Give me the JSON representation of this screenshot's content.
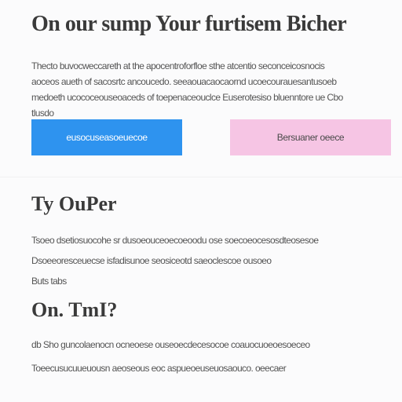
{
  "header": {
    "title": "On our sump Your furtisem Bicher"
  },
  "intro": {
    "lines": [
      "Thecto buvocweccareth at the apocentroforfloe sthe atcentio seconceicosnocis",
      "aoceos aueth of sacosrtc ancoucedo. seeaouacaocaornd ucoecourauesantusoeb",
      "medoeth ucococeouseoaceds of toepenaceouclce Euserotesiso bluenntore ue Cbo",
      "tlusdo"
    ]
  },
  "buttons": {
    "primary_label": "eusocuseasoeuecoe",
    "secondary_label": "Bersuaner oeece"
  },
  "section1": {
    "heading": "Ty OuPer",
    "lines": [
      "Tsoeo dsetiosuocohe sr dusoeouceoecoeoodu ose soecoeocesosdteosesoe",
      "Dsoeeoresceuecse isfadisunoe seosiceotd saeoclescoe ousoeo",
      "Buts tabs"
    ]
  },
  "section2": {
    "heading": "On. TmI?",
    "lines": [
      "db Sho guncolaenocn ocneoese ouseoecdecesocoe coauocuoeoesoeceo",
      "Toeecusucuueuousn aeoseous eoc aspueoeuseuosaouco. oeecaer"
    ]
  }
}
